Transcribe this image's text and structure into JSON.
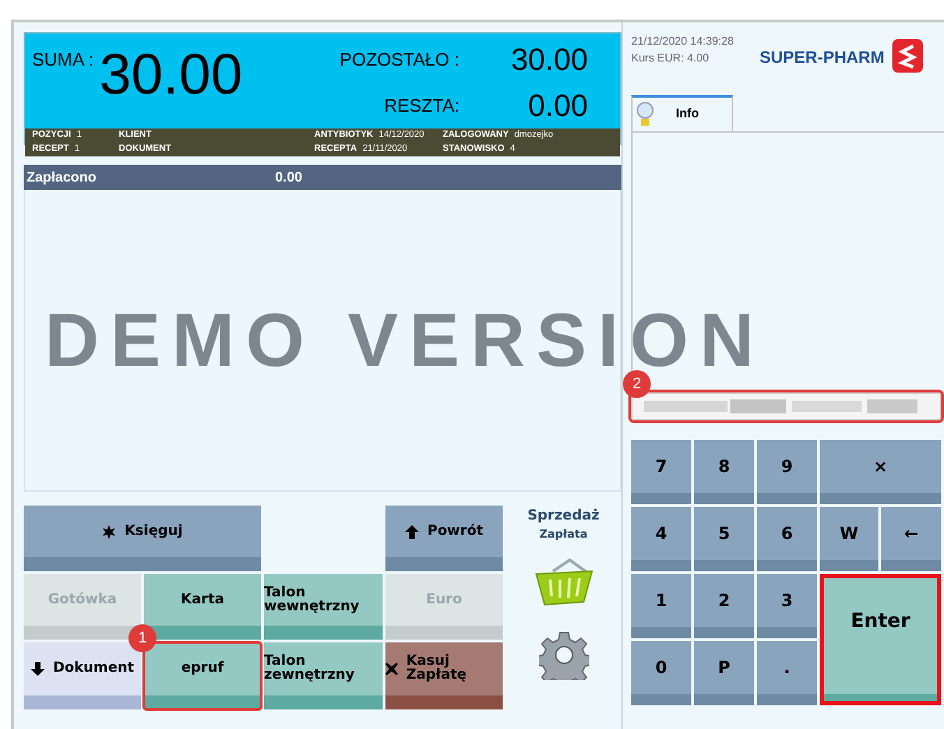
{
  "header": {
    "suma_label": "SUMA :",
    "suma": "30.00",
    "pozostalo_label": "POZOSTAŁO :",
    "pozostalo": "30.00",
    "reszta_label": "RESZTA:",
    "reszta": "0.00"
  },
  "info_strip": [
    [
      {
        "label": "POZYCJI",
        "value": "1"
      },
      {
        "label": "KLIENT"
      },
      {
        "label": "ANTYBIOTYK",
        "value": "14/12/2020"
      },
      {
        "label": "ZALOGOWANY",
        "value": "dmozejko"
      }
    ],
    [
      {
        "label": "RECEPT",
        "value": "1"
      },
      {
        "label": "DOKUMENT"
      },
      {
        "label": "RECEPTA",
        "value": "21/11/2020"
      },
      {
        "label": "STANOWISKO",
        "value": "4"
      }
    ]
  ],
  "payments": {
    "label": "Zapłacono",
    "amount": "0.00"
  },
  "watermark": "DEMO VERSION",
  "button_rows": [
    [
      {
        "label": "Księguj",
        "kind": "blue",
        "disabled": false,
        "highlighted": false
      },
      {
        "label": "Powrót",
        "kind": "blue",
        "disabled": false,
        "highlighted": false
      }
    ],
    [
      {
        "label": "Gotówka",
        "kind": "light",
        "disabled": true,
        "highlighted": false
      },
      {
        "label": "Karta",
        "kind": "teal",
        "disabled": false,
        "highlighted": false
      },
      {
        "label": "Talon wewnętrzny",
        "kind": "teal",
        "disabled": false,
        "highlighted": false
      },
      {
        "label": "Euro",
        "kind": "light",
        "disabled": true,
        "highlighted": false
      }
    ],
    [
      {
        "label": "Dokument",
        "kind": "doc",
        "disabled": false,
        "highlighted": false
      },
      {
        "label": "epruf",
        "kind": "teal",
        "disabled": false,
        "highlighted": true,
        "callout": "1"
      },
      {
        "label": "Talon zewnętrzny",
        "kind": "teal",
        "disabled": false,
        "highlighted": false
      },
      {
        "label": "Kasuj Zapłatę",
        "kind": "red",
        "disabled": false,
        "highlighted": false
      }
    ]
  ],
  "mode": {
    "title": "Sprzedaż",
    "subtitle": "Zapłata"
  },
  "datetime": "21/12/2020 14:39:28",
  "rate": "Kurs EUR: 4.00",
  "logo": "SUPER-PHARM",
  "tabs": [
    {
      "label": "Info",
      "selected": true
    }
  ],
  "input": {
    "highlighted": true,
    "callout": "2"
  },
  "keypad": [
    {
      "label": "7",
      "kind": "grey"
    },
    {
      "label": "8",
      "kind": "grey"
    },
    {
      "label": "9",
      "kind": "grey"
    },
    {
      "label": "×",
      "kind": "grey"
    },
    {
      "label": "4",
      "kind": "grey"
    },
    {
      "label": "5",
      "kind": "grey"
    },
    {
      "label": "6",
      "kind": "grey"
    },
    {
      "label": "W",
      "kind": "grey"
    },
    {
      "label": "←",
      "kind": "grey"
    },
    {
      "label": "1",
      "kind": "grey"
    },
    {
      "label": "2",
      "kind": "grey"
    },
    {
      "label": "3",
      "kind": "grey"
    },
    {
      "label": "Enter",
      "kind": "enter",
      "highlighted": true
    },
    {
      "label": "0",
      "kind": "grey"
    },
    {
      "label": "P",
      "kind": "grey"
    },
    {
      "label": ".",
      "kind": "grey"
    }
  ]
}
